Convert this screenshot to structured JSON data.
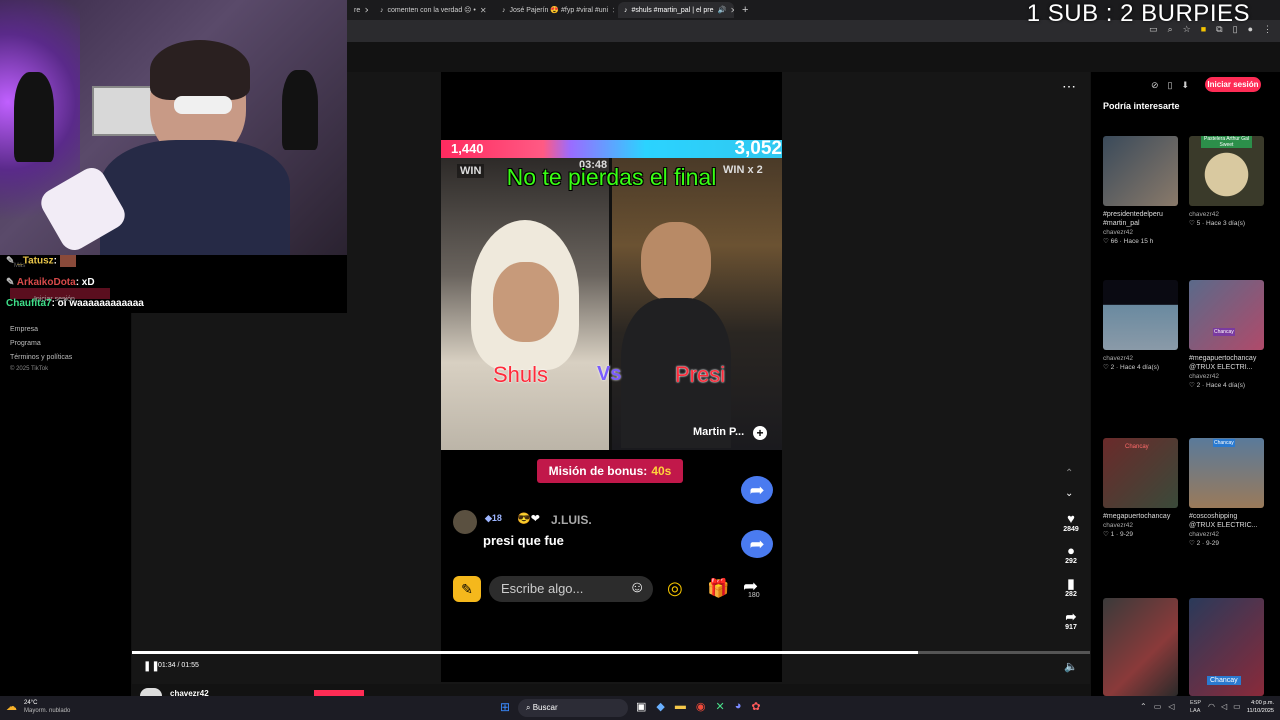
{
  "tabs": [
    {
      "label": "re"
    },
    {
      "label": "comenten con la verdad ☹ •"
    },
    {
      "label": "José Pajerín 😍 #fyp #viral #uni"
    },
    {
      "label": "#shuls #martin_pal | el pre"
    }
  ],
  "stream_overlay": "1 SUB : 2 BURPIES",
  "chat": {
    "lines": [
      {
        "user": "_Tatusz",
        "msg": ":"
      },
      {
        "user": "ArkaikoDota",
        "msg": ": xD"
      },
      {
        "user": "Chaufita7",
        "msg": ": oi waaaaaaaaaaaa"
      }
    ],
    "ghost_mas": "Más",
    "ghost_login": "Iniciar sesión"
  },
  "left_nav": {
    "links": [
      "Empresa",
      "Programa",
      "Términos y políticas",
      "© 2025 TikTok"
    ]
  },
  "video": {
    "score_left": "1,440",
    "score_right": "3,052",
    "timer": "03:48",
    "win_left": "WIN",
    "win_right": "WIN x 2",
    "headline": "No te pierdas el final",
    "name_left": "Shuls",
    "vs": "Vs",
    "name_right": "Presi",
    "creator": "Martin P...",
    "bonus_label": "Misión de bonus:",
    "bonus_time": "40s",
    "commenter_level": "18",
    "commenter": "J.LUIS.",
    "comment": "presi que fue",
    "input_placeholder": "Escribe algo...",
    "share_count": "180"
  },
  "actions": {
    "likes": "2849",
    "comments": "292",
    "saves": "282",
    "shares": "917"
  },
  "progress": {
    "time": "01:34 / 01:55",
    "fraction": 0.82
  },
  "right": {
    "login_button": "Iniciar sesión",
    "heading": "Podría interesarte",
    "items": [
      {
        "caption": "#presidentedelperu #martin_pal",
        "user": "chavezr42",
        "stats": "♡ 66 · Hace 15 h"
      },
      {
        "caption": "",
        "user": "chavezr42",
        "stats": "♡ 5 · Hace 3 día(s)"
      },
      {
        "caption": "",
        "user": "chavezr42",
        "stats": "♡ 2 · Hace 4 día(s)"
      },
      {
        "caption": "#megapuertochancay @TRUX ELECTRI...",
        "user": "chavezr42",
        "stats": "♡ 2 · Hace 4 día(s)"
      },
      {
        "caption": "#megapuertochancay",
        "user": "chavezr42",
        "stats": "♡ 1 · 9-29"
      },
      {
        "caption": "#coscoshipping @TRUX ELECTRIC...",
        "user": "chavezr42",
        "stats": "♡ 2 · 9-29"
      }
    ],
    "thumb_texts": [
      "Pastelera Arthur Gal Sweet",
      "Chancay",
      "Chancay",
      "Chancay",
      "Chancay"
    ]
  },
  "author_peek": "chavezr42",
  "taskbar": {
    "weather_temp": "24°C",
    "weather_desc": "Mayorm. nublado",
    "search": "Buscar",
    "lang": "ESP LAA",
    "time": "4:00 p.m.",
    "date": "11/10/2025"
  }
}
